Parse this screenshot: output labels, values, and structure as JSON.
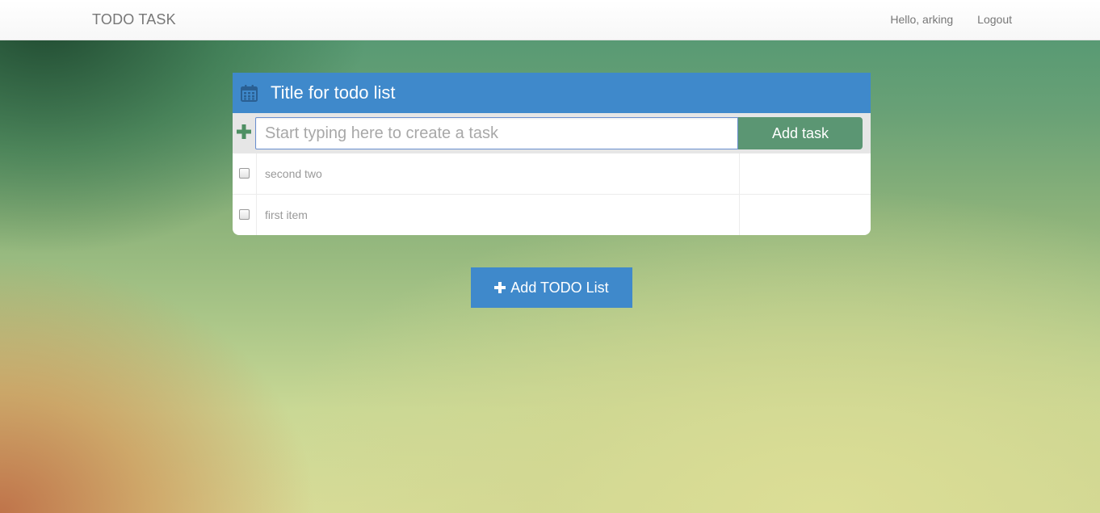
{
  "navbar": {
    "brand": "TODO TASK",
    "greeting": "Hello, arking",
    "logout_label": "Logout"
  },
  "todo_list": {
    "title": "Title for todo list",
    "input_placeholder": "Start typing here to create a task",
    "input_value": "",
    "add_task_label": "Add task",
    "tasks": [
      {
        "text": "second two",
        "checked": false
      },
      {
        "text": "first item",
        "checked": false
      }
    ]
  },
  "add_list_button_label": "Add TODO List",
  "colors": {
    "header_blue": "#3f89cb",
    "add_task_green": "#5b9673",
    "plus_green": "#4e8f63"
  },
  "icons": {
    "header": "calendar-icon",
    "add_row": "plus-icon",
    "add_list": "plus-icon"
  }
}
